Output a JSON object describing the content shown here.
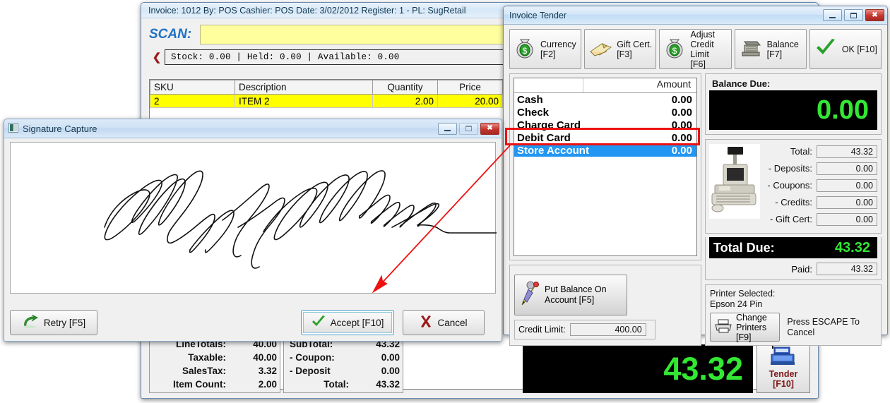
{
  "invoice_window": {
    "title": "Invoice: 1012  By: POS  Cashier: POS   Date: 3/02/2012  Register: 1 - PL: SugRetail",
    "scan_label": "SCAN:",
    "scan_value": "",
    "scan_placeholder": "",
    "stock_line": "Stock:         0.00 | Held:         0.00 | Available:        0.00",
    "grid": {
      "columns": [
        "SKU",
        "Description",
        "Quantity",
        "Price"
      ],
      "rows": [
        {
          "sku": "2",
          "description": "ITEM 2",
          "quantity": "2.00",
          "price": "20.00"
        }
      ]
    },
    "totals_left": [
      {
        "label": "LineTotals:",
        "value": "40.00"
      },
      {
        "label": "Taxable:",
        "value": "40.00"
      },
      {
        "label": "SalesTax:",
        "value": "3.32"
      },
      {
        "label": "Item Count:",
        "value": "2.00"
      }
    ],
    "totals_right": [
      {
        "label": "SubTotal:",
        "value": "43.32"
      },
      {
        "label": "- Coupon:",
        "value": "0.00"
      },
      {
        "label": "- Deposit",
        "value": "0.00"
      },
      {
        "label": "Total:",
        "value": "43.32"
      }
    ],
    "lcd_amount": "43.32",
    "tender_button": "Tender\n[F10]"
  },
  "tender_window": {
    "title": "Invoice Tender",
    "toolbar": [
      {
        "icon": "money-bag-icon",
        "label": "Currency\n[F2]"
      },
      {
        "icon": "gift-cert-icon",
        "label": "Gift Cert.\n[F3]"
      },
      {
        "icon": "money-bag-icon",
        "label": "Adjust\nCredit Limit\n[F6]"
      },
      {
        "icon": "cash-register-icon",
        "label": "Balance\n[F7]"
      },
      {
        "icon": "green-check-icon",
        "label": "OK [F10]"
      }
    ],
    "tender_list": {
      "header_name": "",
      "header_amount": "Amount",
      "rows": [
        {
          "name": "Cash",
          "amount": "0.00",
          "selected": false
        },
        {
          "name": "Check",
          "amount": "0.00",
          "selected": false
        },
        {
          "name": "Charge Card",
          "amount": "0.00",
          "selected": false
        },
        {
          "name": "Debit Card",
          "amount": "0.00",
          "selected": false
        },
        {
          "name": "Store Account",
          "amount": "0.00",
          "selected": true
        }
      ]
    },
    "put_balance_button": "Put Balance On\nAccount [F5]",
    "credit_limit_label": "Credit Limit:",
    "credit_limit_value": "400.00",
    "balance_due_label": "Balance Due:",
    "balance_due_value": "0.00",
    "summary": [
      {
        "label": "Total:",
        "value": "43.32"
      },
      {
        "label": "- Deposits:",
        "value": "0.00"
      },
      {
        "label": "- Coupons:",
        "value": "0.00"
      },
      {
        "label": "- Credits:",
        "value": "0.00"
      },
      {
        "label": "- Gift Cert:",
        "value": "0.00"
      }
    ],
    "total_due_label": "Total Due:",
    "total_due_value": "43.32",
    "paid_label": "Paid:",
    "paid_value": "43.32",
    "printer_label": "Printer Selected:",
    "printer_name": "Epson 24 Pin",
    "change_printers_button": "Change\nPrinters [F9]",
    "escape_hint": "Press ESCAPE To Cancel"
  },
  "signature_window": {
    "title": "Signature Capture",
    "retry_button": "Retry [F5]",
    "accept_button": "Accept [F10]",
    "cancel_button": "Cancel"
  },
  "colors": {
    "highlight_blue": "#2196f3",
    "annotation_red": "#ee1111",
    "lcd_green": "#33e833",
    "scan_yellow": "#ffff9e",
    "row_yellow": "#ffff00"
  }
}
